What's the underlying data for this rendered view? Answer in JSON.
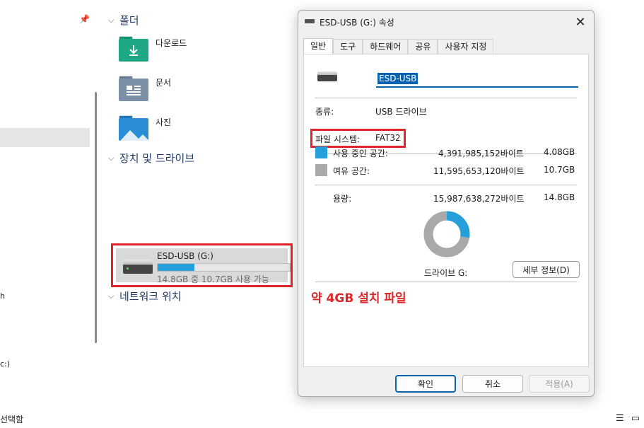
{
  "explorer": {
    "left_fragments": [
      "h",
      "c:)"
    ],
    "status": {
      "selected_text": "선택함",
      "icons": [
        "details-view-icon",
        "tiles-view-icon"
      ]
    },
    "sections": {
      "folders": "폴더",
      "devices": "장치 및 드라이브",
      "network": "네트워크 위치"
    },
    "folders": [
      {
        "label": "다운로드",
        "color": "#1ea886",
        "icon": "download-folder-icon"
      },
      {
        "label": "문서",
        "color": "#7b8fa6",
        "icon": "documents-folder-icon"
      },
      {
        "label": "사진",
        "color": "#2a8ed6",
        "icon": "pictures-folder-icon"
      }
    ],
    "drive": {
      "name": "ESD-USB (G:)",
      "free_text": "14.8GB 중 10.7GB 사용 가능",
      "used_fraction": 0.276,
      "bar_color": "#26a0da"
    }
  },
  "dialog": {
    "title": "ESD-USB (G:) 속성",
    "tabs": [
      "일반",
      "도구",
      "하드웨어",
      "공유",
      "사용자 지정"
    ],
    "active_tab": 0,
    "name_value": "ESD-USB",
    "type_label": "종류:",
    "type_value": "USB 드라이브",
    "fs_label": "파일 시스템:",
    "fs_value": "FAT32",
    "used_label": "사용 중인 공간:",
    "used_bytes": "4,391,985,152바이트",
    "used_gb": "4.08GB",
    "free_label": "여유 공간:",
    "free_bytes": "11,595,653,120바이트",
    "free_gb": "10.7GB",
    "capacity_label": "용량:",
    "capacity_bytes": "15,987,638,272바이트",
    "capacity_gb": "14.8GB",
    "drive_letter": "드라이브 G:",
    "detail_button": "세부 정보(D)",
    "annotation": "약 4GB 설치 파일",
    "used_color": "#26a0da",
    "free_color": "#a9a9a9",
    "used_fraction": 0.275,
    "buttons": {
      "ok": "확인",
      "cancel": "취소",
      "apply": "적용(A)"
    }
  }
}
